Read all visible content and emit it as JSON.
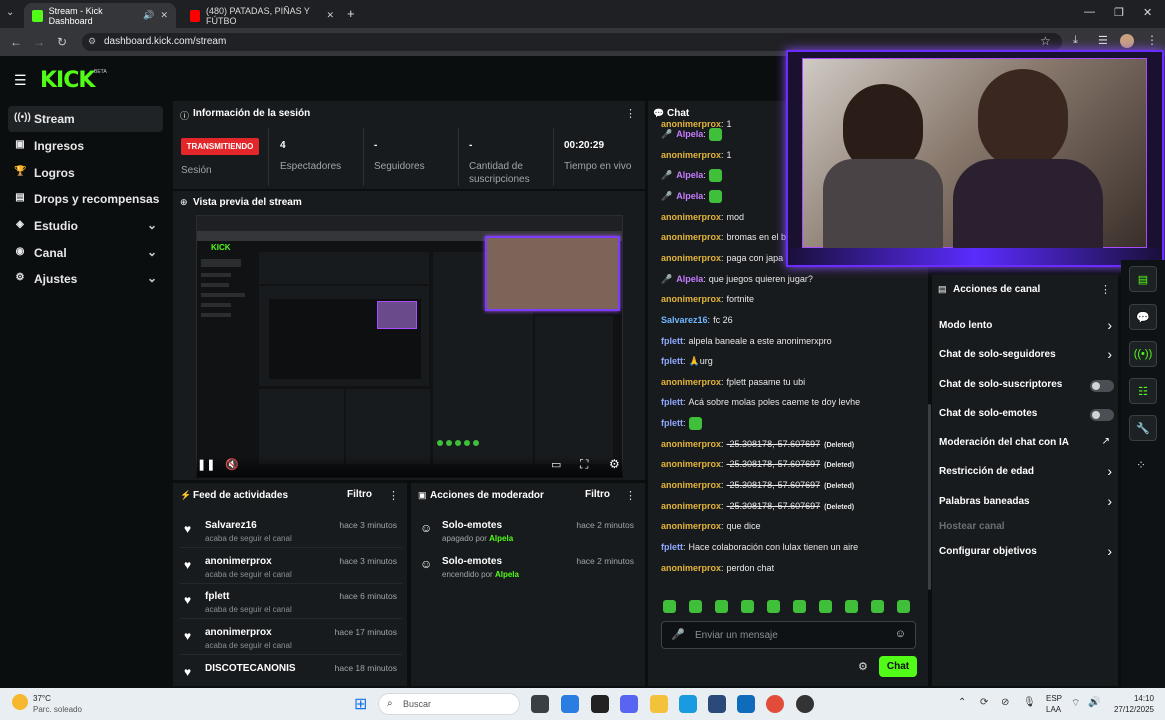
{
  "browser": {
    "tabs": [
      {
        "title": "Stream - Kick Dashboard",
        "active": true
      },
      {
        "title": "(480) PATADAS, PIÑAS Y FÚTBO",
        "active": false
      }
    ],
    "url": "dashboard.kick.com/stream"
  },
  "brand": {
    "logo": "KICK",
    "beta": "BETA",
    "accent": "#53fc18"
  },
  "sidebar": {
    "items": [
      {
        "label": "Stream",
        "icon": "stream-icon"
      },
      {
        "label": "Ingresos",
        "icon": "revenue-icon"
      },
      {
        "label": "Logros",
        "icon": "trophy-icon"
      },
      {
        "label": "Drops y recompensas",
        "icon": "gift-icon"
      },
      {
        "label": "Estudio",
        "icon": "studio-icon"
      },
      {
        "label": "Canal",
        "icon": "channel-icon"
      },
      {
        "label": "Ajustes",
        "icon": "gear-icon"
      }
    ]
  },
  "session": {
    "title": "Información de la sesión",
    "badge": "TRANSMITIENDO",
    "badge_label": "Sesión",
    "stats": [
      {
        "value": "4",
        "label": "Espectadores"
      },
      {
        "value": "-",
        "label": "Seguidores"
      },
      {
        "value": "-",
        "label": "Cantidad de suscripciones"
      },
      {
        "value": "00:20:29",
        "label": "Tiempo en vivo"
      }
    ]
  },
  "preview": {
    "title": "Vista previa del stream"
  },
  "feed": {
    "title": "Feed de actividades",
    "filter": "Filtro",
    "items": [
      {
        "name": "Salvarez16",
        "sub": "acaba de seguir el canal",
        "time": "hace 3 minutos"
      },
      {
        "name": "anonimerprox",
        "sub": "acaba de seguir el canal",
        "time": "hace 3 minutos"
      },
      {
        "name": "fplett",
        "sub": "acaba de seguir el canal",
        "time": "hace 6 minutos"
      },
      {
        "name": "anonimerprox",
        "sub": "acaba de seguir el canal",
        "time": "hace 17 minutos"
      },
      {
        "name": "DISCOTECANONIS",
        "sub": "",
        "time": "hace 18 minutos"
      }
    ]
  },
  "modactions": {
    "title": "Acciones de moderador",
    "filter": "Filtro",
    "items": [
      {
        "name": "Solo-emotes",
        "sub": "apagado por",
        "by": "Alpela",
        "time": "hace 2 minutos"
      },
      {
        "name": "Solo-emotes",
        "sub": "encendido por",
        "by": "Alpela",
        "time": "hace 2 minutos"
      }
    ]
  },
  "chat": {
    "title": "Chat",
    "messages": [
      {
        "user": "anonimerprox",
        "text": "1"
      },
      {
        "user": "Alpela",
        "text": "",
        "emote": true
      },
      {
        "user": "anonimerprox",
        "text": "1"
      },
      {
        "user": "Alpela",
        "text": "",
        "emote": true
      },
      {
        "user": "Alpela",
        "text": "",
        "emote": true
      },
      {
        "user": "anonimerprox",
        "text": "mod"
      },
      {
        "user": "anonimerprox",
        "text": "bromas en el bo"
      },
      {
        "user": "anonimerprox",
        "text": "paga con japa"
      },
      {
        "user": "Alpela",
        "text": "que juegos quieren jugar?"
      },
      {
        "user": "anonimerprox",
        "text": "fortnite"
      },
      {
        "user": "Salvarez16",
        "text": "fc 26"
      },
      {
        "user": "fplett",
        "text": "alpela baneale a este anonimerxpro"
      },
      {
        "user": "fplett",
        "text": "🙏urg"
      },
      {
        "user": "anonimerprox",
        "text": "fplett pasame tu ubi"
      },
      {
        "user": "fplett",
        "text": "Acá sobre molas poles caeme te doy levhe"
      },
      {
        "user": "fplett",
        "text": "",
        "emote": true
      },
      {
        "user": "anonimerprox",
        "text": "-25.308178,-57.607697",
        "deleted": "(Deleted)"
      },
      {
        "user": "anonimerprox",
        "text": "-25.308178,-57.607697",
        "deleted": "(Deleted)"
      },
      {
        "user": "anonimerprox",
        "text": "-25.308178,-57.607697",
        "deleted": "(Deleted)"
      },
      {
        "user": "anonimerprox",
        "text": "-25.308178,-57.607697",
        "deleted": "(Deleted)"
      },
      {
        "user": "anonimerprox",
        "text": "que dice"
      },
      {
        "user": "fplett",
        "text": "Hace colaboración con lulax tienen un aire"
      },
      {
        "user": "anonimerprox",
        "text": "perdon chat"
      }
    ],
    "user_colors": {
      "anonimerprox": "#e4b43a",
      "Alpela": "#c77dff",
      "Salvarez16": "#6fb7ff",
      "fplett": "#8fa8ff"
    },
    "input_placeholder": "Enviar un mensaje",
    "send_label": "Chat"
  },
  "channel_actions": {
    "title": "Acciones de canal",
    "items": [
      {
        "label": "Modo lento",
        "control": "chevron"
      },
      {
        "label": "Chat de solo-seguidores",
        "control": "chevron"
      },
      {
        "label": "Chat de solo-suscriptores",
        "control": "toggle"
      },
      {
        "label": "Chat de solo-emotes",
        "control": "toggle"
      },
      {
        "label": "Moderación del chat con IA",
        "control": "external"
      },
      {
        "label": "Restricción de edad",
        "control": "chevron"
      },
      {
        "label": "Palabras baneadas",
        "control": "chevron"
      },
      {
        "label": "Hostear canal",
        "control": "none",
        "disabled": true
      },
      {
        "label": "Configurar objetivos",
        "control": "chevron"
      }
    ]
  },
  "taskbar": {
    "weather_temp": "37°C",
    "weather_desc": "Parc. soleado",
    "search": "Buscar",
    "lang": "ESP",
    "lang2": "LAA",
    "time": "14:10",
    "date": "27/12/2025"
  }
}
